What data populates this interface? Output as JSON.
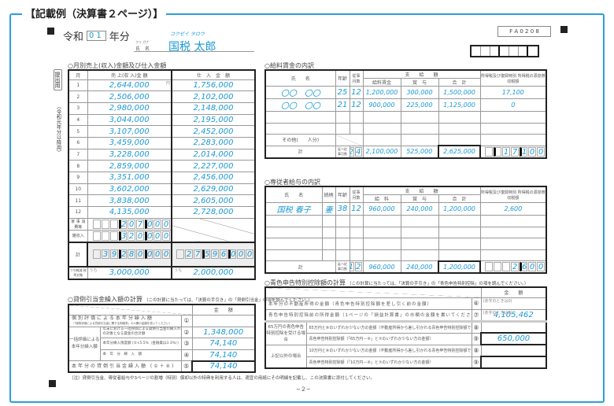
{
  "title": "【記載例（決算書２ページ）】",
  "header": {
    "era": "令和",
    "year": "01",
    "year_suffix": "年分",
    "furigana_label": "フリ ガナ",
    "name_label": "氏　名",
    "furigana": "コクゼイ タロウ",
    "name": "国税 太郎",
    "form_code": "F A 0 2 0 8"
  },
  "side": {
    "submit": "提出用",
    "period": "（令和元年分以降用）"
  },
  "monthly": {
    "title": "○月別売上(収入)金額及び仕入金額",
    "headers": [
      "月",
      "売 上(収 入)金 額",
      "仕　入　金　額"
    ],
    "yen": "円",
    "rows": [
      [
        "1",
        "2,644,000",
        "1,756,000"
      ],
      [
        "2",
        "2,506,000",
        "2,102,000"
      ],
      [
        "3",
        "2,980,000",
        "2,148,000"
      ],
      [
        "4",
        "3,044,000",
        "2,195,000"
      ],
      [
        "5",
        "3,107,000",
        "2,452,000"
      ],
      [
        "6",
        "3,459,000",
        "2,283,000"
      ],
      [
        "7",
        "3,228,000",
        "2,014,000"
      ],
      [
        "8",
        "2,859,000",
        "2,227,000"
      ],
      [
        "9",
        "3,351,000",
        "2,456,000"
      ],
      [
        "10",
        "3,602,000",
        "2,629,000"
      ],
      [
        "11",
        "3,838,000",
        "2,605,000"
      ],
      [
        "12",
        "4,135,000",
        "2,728,000"
      ]
    ],
    "household_label": "家 事 消費等",
    "household": "207000",
    "misc_label": "雑収入",
    "misc": "320000",
    "total_label": "計",
    "total_sales": "39280000",
    "total_purchase": "27596000",
    "reduced_label": "うち軽減 税率対象",
    "uchi": "うち",
    "reduced_sales": "3,000,000",
    "reduced_purchase": "2,000,000"
  },
  "salary": {
    "title": "○給料賃金の内訳",
    "headers": {
      "name": "氏　　名",
      "age": "年齢",
      "months": "従事 月数",
      "pay": "支　　給　　額",
      "wage": "給料賃金",
      "bonus": "賞　与",
      "sum": "合　計",
      "tax": "所得税及び復興特別 所得税の源泉徴収税額"
    },
    "rows": [
      [
        "〇〇　〇〇",
        "25",
        "12",
        "1,200,000",
        "300,000",
        "1,500,000",
        "17,100"
      ],
      [
        "〇〇　〇〇",
        "21",
        "12",
        "900,000",
        "225,000",
        "1,125,000",
        "0"
      ]
    ],
    "others_label": "その他(　　人分)",
    "total_label": "計",
    "months_label": "延べ従 事月数",
    "total_months": "24",
    "total_wage": "2,100,000",
    "total_bonus": "525,000",
    "total_sum": "2,625,000",
    "total_tax": "17100",
    "age_unit": "歳",
    "month_unit": "月",
    "yen": "円"
  },
  "family": {
    "title": "○専従者給与の内訳",
    "headers": {
      "name": "氏　　名",
      "relation": "続柄",
      "age": "年齢",
      "months": "従事 月数",
      "pay": "支　　給　　額",
      "wage": "給　料",
      "bonus": "賞　与",
      "sum": "合　計",
      "tax": "所得税及び復興特別 所得税の源泉徴収税額"
    },
    "rows": [
      [
        "国税 春子",
        "妻",
        "38",
        "12",
        "960,000",
        "240,000",
        "1,200,000",
        "2,600"
      ]
    ],
    "total_label": "計",
    "months_label": "延べ従 事月数",
    "total_months": "12",
    "total_wage": "960,000",
    "total_bonus": "240,000",
    "total_sum": "1,200,000",
    "total_tax": "2600"
  },
  "bad_debt": {
    "title": "○貸倒引当金繰入額の計算",
    "note": "（この計算に当たっては、「決算の手引き」の「貸倒引当金」の項を読んでください。）",
    "amount_header": "金　　額",
    "rows": [
      {
        "label": "個別評価による本年分繰入額",
        "sub": "（「個別評価による貸倒引当金に関する明細書」の①欄の金額を書いてください）",
        "no": "①",
        "value": ""
      },
      {
        "group": "一括評価による本年分繰入額",
        "label": "年末における一括評価による貸倒引当金の繰入れの対象となる貸金の合計額",
        "no": "②",
        "value": "1,348,000"
      },
      {
        "label": "本年分繰入限度額 (②×5.5%（金融業は3.3%）)",
        "no": "③",
        "value": "74,140"
      },
      {
        "label": "本　年　分　繰　入　額",
        "no": "④",
        "value": "74,140"
      },
      {
        "label": "本年分の貸倒引当金繰入額 (①＋④)",
        "no": "⑤",
        "value": "74,140"
      }
    ]
  },
  "blue": {
    "title": "○青色申告特別控除額の計算",
    "note": "（この計算に当たっては、「決算の手引き」の「青色申告特別控除」の項を読んでください。）",
    "amount_header": "金　　額",
    "red_note": "(赤字のときは0)",
    "rows": [
      {
        "label": "本年分の不動産所得の金額（青色申告特別控除額を差し引く前の金額）",
        "no": "⑥",
        "value": ""
      },
      {
        "label": "青色申告特別控除前の所得金額（1ページの「損益計算書」の㊸欄の金額を書いてください。）",
        "no": "⑦",
        "value": "4,105,462"
      },
      {
        "group": "65万円の青色申告特別控除を受ける場合",
        "label": "65万円と⑥のいずれか少ない方の金額（不動産所得から差し引かれる青色申告特別控除額です。）",
        "no": "⑧",
        "value": ""
      },
      {
        "label": "青色申告特別控除額（「65万円－⑧」と⑦のいずれか少ない方の金額）",
        "no": "⑨",
        "value": "650,000"
      },
      {
        "group": "上記以外の場合",
        "label": "10万円と⑥のいずれか少ない方の金額（不動産所得から差し引かれる青色申告特別控除額です。）",
        "no": "⑧",
        "value": ""
      },
      {
        "label": "青色申告特別控除額（「10万円－⑧」と⑦のいずれか少ない方の金額）",
        "no": "⑨",
        "value": ""
      }
    ]
  },
  "footnote": "（注）貸倒引当金、専従者給与や3ページの割増（特別）償却以外の特典を利用する人は、適宜の用紙にその明細を記載し、この決算書に添付してください。",
  "page_number": "−２−"
}
